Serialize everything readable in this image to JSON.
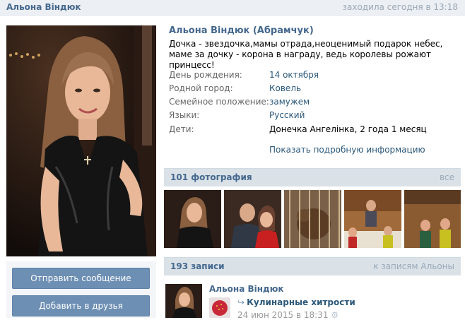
{
  "header": {
    "name": "Альона Віндюк",
    "last_seen": "заходила сегодня в 13:18"
  },
  "profile": {
    "full_name": "Альона Віндюк (Абрамчук)",
    "status": "Дочка - звездочка,мамы отрада,неоценимый подарок небес, маме за дочку - корона в награду, ведь королевы рожают принцесс!",
    "info": [
      {
        "label": "День рождения:",
        "value": "14 октября"
      },
      {
        "label": "Родной город:",
        "value": "Ковель"
      },
      {
        "label": "Семейное положение:",
        "value": "замужем"
      },
      {
        "label": "Языки:",
        "value": "Русский"
      },
      {
        "label": "Дети:",
        "value": "Донечка Ангелінка, 2 года 1 месяц"
      }
    ],
    "show_more": "Показать подробную информацию"
  },
  "actions": {
    "send_message": "Отправить сообщение",
    "add_friend": "Добавить в друзья"
  },
  "photos": {
    "title": "101 фотография",
    "all_link": "все"
  },
  "wall": {
    "title": "193 записи",
    "link": "к записям Альоны",
    "post": {
      "author": "Альона Віндюк",
      "repost_title": "Кулинарные хитрости",
      "date": "24 июн 2015 в 18:31"
    }
  }
}
